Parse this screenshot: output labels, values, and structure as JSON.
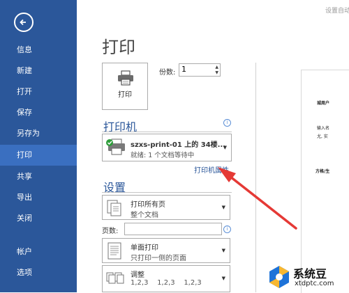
{
  "sidebar": {
    "items": [
      {
        "label": "信息"
      },
      {
        "label": "新建"
      },
      {
        "label": "打开"
      },
      {
        "label": "保存"
      },
      {
        "label": "另存为"
      },
      {
        "label": "打印"
      },
      {
        "label": "共享"
      },
      {
        "label": "导出"
      },
      {
        "label": "关闭"
      },
      {
        "label": "帐户"
      },
      {
        "label": "选项"
      }
    ],
    "active": "打印",
    "color": "#2b579a"
  },
  "top_hint": "设置自动",
  "main": {
    "title": "打印",
    "print_button_label": "打印",
    "copies_label": "份数:",
    "copies_value": "1"
  },
  "printer": {
    "section_title": "打印机",
    "name": "szxs-print-01 上的 34楼...",
    "status": "就绪: 1 个文档等待中",
    "properties_link": "打印机属性"
  },
  "settings": {
    "section_title": "设置",
    "print_range_main": "打印所有页",
    "print_range_sub": "整个文档",
    "pages_label": "页数:",
    "pages_value": "",
    "sides_main": "单面打印",
    "sides_sub": "只打印一侧的页面",
    "collate_main": "调整",
    "collate_sub": "1,2,3    1,2,3    1,2,3"
  },
  "preview": {
    "line1": "城周户",
    "line2": "输入名",
    "line3": "尤, 实",
    "line4": "方格/生"
  },
  "watermark": {
    "name": "系统豆",
    "url": "xtdptc.com"
  },
  "colors": {
    "accent": "#2b579a",
    "arrow": "#e53935"
  }
}
